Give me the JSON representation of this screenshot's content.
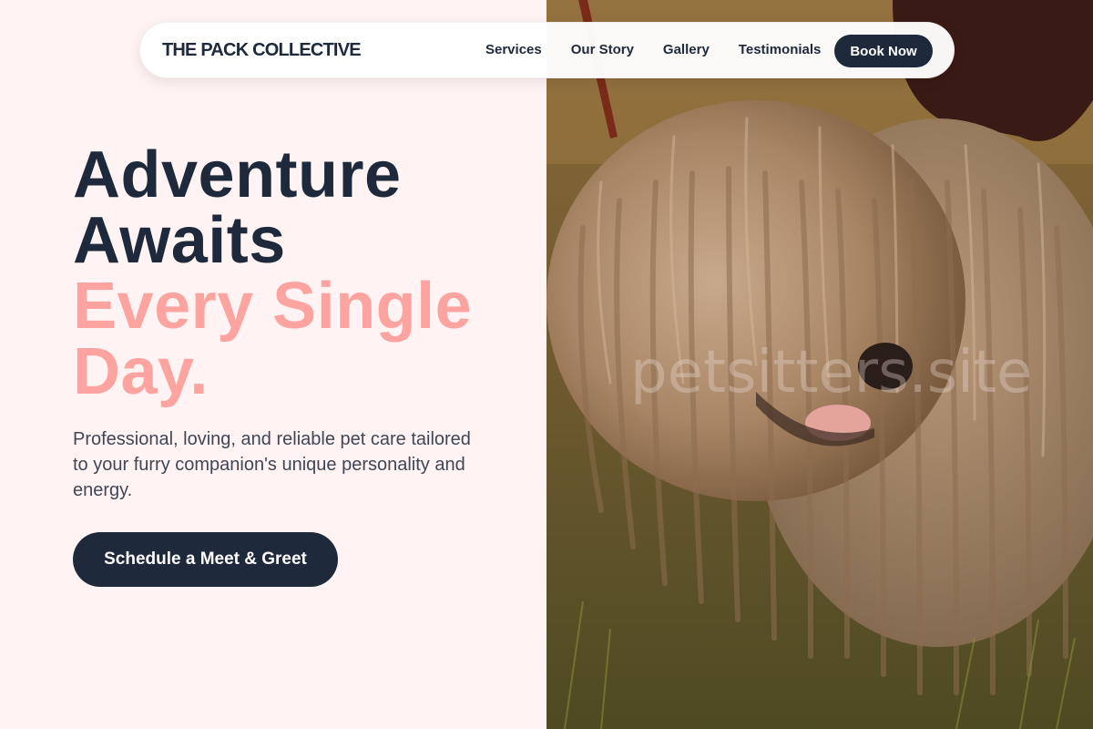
{
  "navbar": {
    "brand": "THE PACK COLLECTIVE",
    "links": [
      "Services",
      "Our Story",
      "Gallery",
      "Testimonials"
    ],
    "cta": "Book Now"
  },
  "hero": {
    "headline_dark_1": "Adventure",
    "headline_dark_2": "Awaits",
    "headline_accent_1": "Every Single",
    "headline_accent_2": "Day.",
    "lead": "Professional, loving, and reliable pet care tailored to your furry companion's unique personality and energy.",
    "cta": "Schedule a Meet & Greet",
    "watermark": "petsitters.site"
  },
  "colors": {
    "background": "#fff4f3",
    "navy": "#1e293b",
    "accent": "#fda4a0"
  }
}
